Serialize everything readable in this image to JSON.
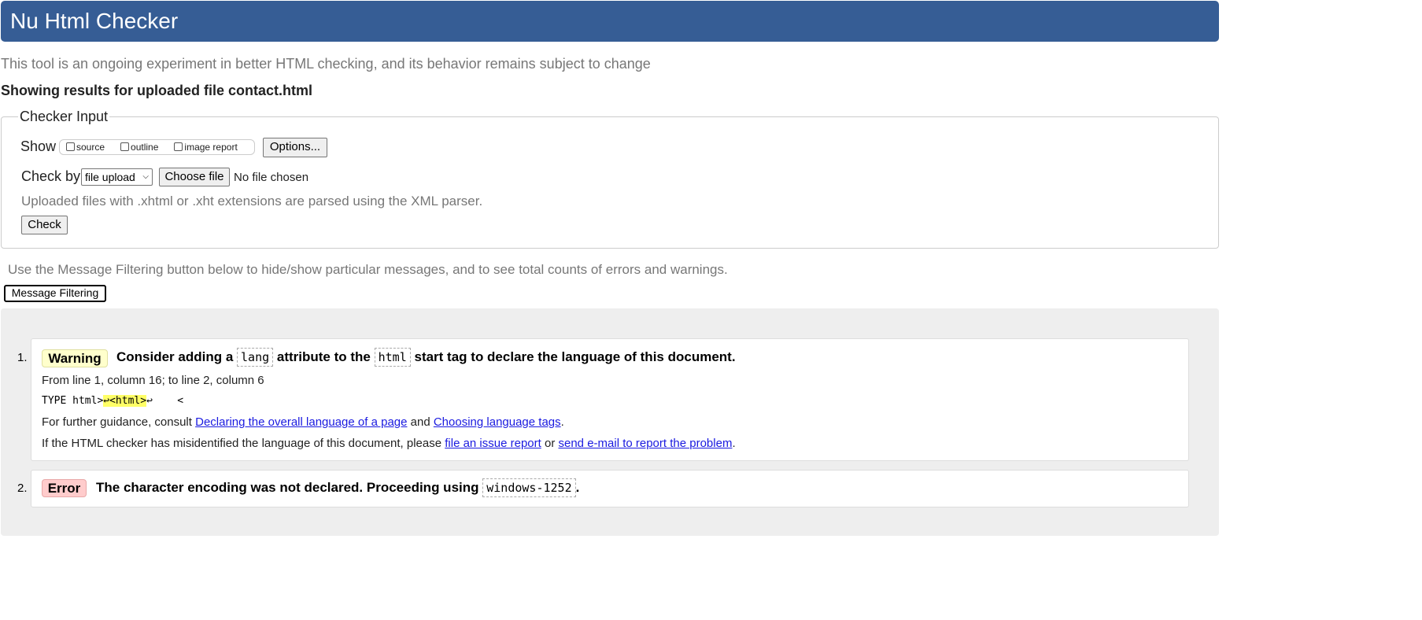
{
  "header": {
    "title": "Nu Html Checker"
  },
  "tagline": "This tool is an ongoing experiment in better HTML checking, and its behavior remains subject to change",
  "showing": "Showing results for uploaded file contact.html",
  "checker_input": {
    "legend": "Checker Input",
    "show_label": "Show",
    "show_options": [
      "source",
      "outline",
      "image report"
    ],
    "options_button": "Options...",
    "check_by_label": "Check by",
    "check_by_selected": "file upload",
    "choose_file_button": "Choose file",
    "no_file": "No file chosen",
    "xml_note": "Uploaded files with .xhtml or .xht extensions are parsed using the XML parser.",
    "check_button": "Check"
  },
  "filter_note": "Use the Message Filtering button below to hide/show particular messages, and to see total counts of errors and warnings.",
  "filter_button": "Message Filtering",
  "messages": [
    {
      "number": "1.",
      "type": "Warning",
      "text_1": "Consider adding a",
      "code_1": "lang",
      "text_2": "attribute to the",
      "code_2": "html",
      "text_3": "start tag to declare the language of this document.",
      "location": "From line 1, column 16; to line 2, column 6",
      "extract_pre": "TYPE html>",
      "extract_hl": "↩<html>",
      "extract_post": "↩    <",
      "guidance_pre": "For further guidance, consult",
      "link_1": "Declaring the overall language of a page",
      "guidance_and": "and",
      "link_2": "Choosing language tags",
      "guidance_end": ".",
      "misidentified_pre": "If the HTML checker has misidentified the language of this document, please",
      "link_3": "file an issue report",
      "misidentified_or": "or",
      "link_4": "send e-mail to report the problem",
      "misidentified_end": "."
    },
    {
      "number": "2.",
      "type": "Error",
      "text_1": "The character encoding was not declared. Proceeding using",
      "code_1": "windows-1252",
      "text_2": "."
    }
  ]
}
